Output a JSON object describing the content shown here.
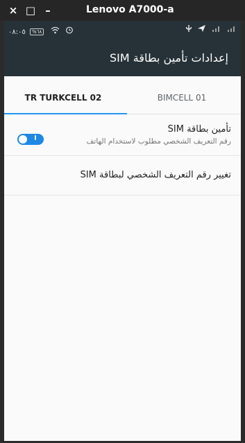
{
  "window": {
    "close_glyph": "×",
    "maximize_glyph": "□",
    "minimize_glyph": "–",
    "title": "Lenovo A7000-a"
  },
  "status_bar": {
    "clock": "٠٨:٠٥",
    "battery": "%٦٨"
  },
  "app_bar": {
    "title": "إعدادات تأمين بطاقة SIM"
  },
  "tabs": [
    {
      "label": "TR TURKCELL 02",
      "selected": true
    },
    {
      "label": "BIMCELL 01",
      "selected": false
    }
  ],
  "settings": {
    "lock_sim": {
      "title": "تأمين بطاقة SIM",
      "subtitle": "رقم التعريف الشخصي مطلوب لاستخدام الهاتف",
      "enabled": true
    },
    "change_pin": {
      "title": "تغيير رقم التعريف الشخصي لبطاقة SIM"
    }
  },
  "colors": {
    "app_bar": "#263238",
    "accent": "#2196f3",
    "background": "#fafafa"
  }
}
